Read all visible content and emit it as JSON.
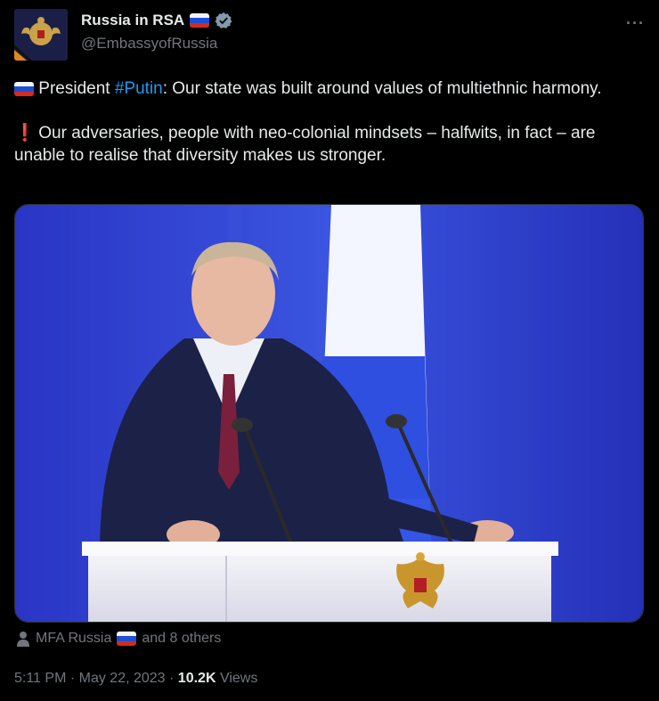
{
  "account": {
    "display_name": "Russia in RSA",
    "handle": "@EmbassyofRussia",
    "verified": true,
    "avatar_icon": "double-headed-eagle-emblem-icon"
  },
  "menu": {
    "more_label": "···"
  },
  "post": {
    "line1_prefix": "President ",
    "hashtag": "#Putin",
    "line1_suffix": ": Our state was built around values of multiethnic harmony.",
    "line2_marker": "❗",
    "line2": "Our adversaries, people with neo-colonial mindsets – halfwits, in fact – are unable to realise that diversity makes us stronger."
  },
  "liked_by": {
    "name": "MFA Russia",
    "suffix": "and 8 others"
  },
  "meta": {
    "time": "5:11 PM",
    "separator": " · ",
    "date": "May 22, 2023",
    "views_count": "10.2K",
    "views_label": "Views"
  },
  "colors": {
    "background": "#000000",
    "hashtag": "#1d9bf0",
    "muted": "#71767b",
    "text": "#e7e9ea"
  }
}
